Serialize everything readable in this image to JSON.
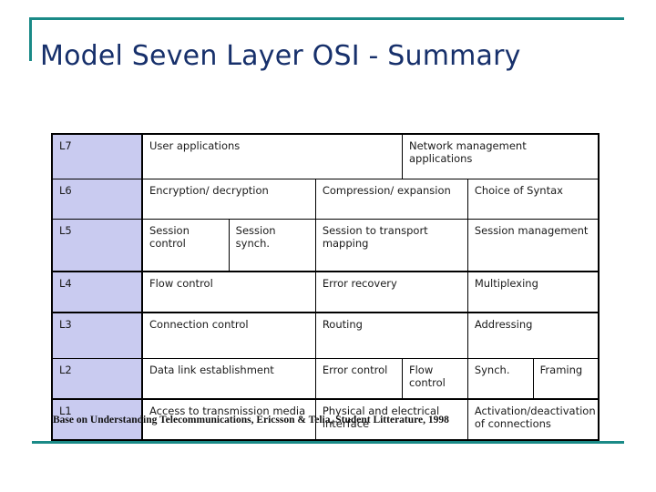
{
  "slide": {
    "title": "Model Seven Layer OSI - Summary",
    "accent_color": "#1a8a87",
    "title_color": "#17306b",
    "layer_cell_color": "#c9cbf0",
    "caption": "Base on Understanding Telecommunications, Ericsson & Telia, Student Litterature, 1998"
  },
  "table": {
    "rows": [
      {
        "layer": "L7",
        "cells": [
          {
            "text": "User applications"
          },
          {
            "text": "Network management applications"
          }
        ]
      },
      {
        "layer": "L6",
        "cells": [
          {
            "text": "Encryption/ decryption"
          },
          {
            "text": "Compression/ expansion"
          },
          {
            "text": "Choice of Syntax"
          }
        ]
      },
      {
        "layer": "L5",
        "cells": [
          {
            "text": "Session control"
          },
          {
            "text": "Session synch."
          },
          {
            "text": "Session to transport mapping"
          },
          {
            "text": "Session management"
          }
        ]
      },
      {
        "layer": "L4",
        "cells": [
          {
            "text": "Flow control"
          },
          {
            "text": "Error recovery"
          },
          {
            "text": "Multiplexing"
          }
        ]
      },
      {
        "layer": "L3",
        "cells": [
          {
            "text": "Connection control"
          },
          {
            "text": "Routing"
          },
          {
            "text": "Addressing"
          }
        ]
      },
      {
        "layer": "L2",
        "cells": [
          {
            "text": "Data link establishment"
          },
          {
            "text": "Error control"
          },
          {
            "text": "Flow control"
          },
          {
            "text": "Synch."
          },
          {
            "text": "Framing"
          }
        ]
      },
      {
        "layer": "L1",
        "cells": [
          {
            "text": "Access to transmission media"
          },
          {
            "text": "Physical and electrical interface"
          },
          {
            "text": "Activation/deactivation of connections"
          }
        ]
      }
    ]
  }
}
